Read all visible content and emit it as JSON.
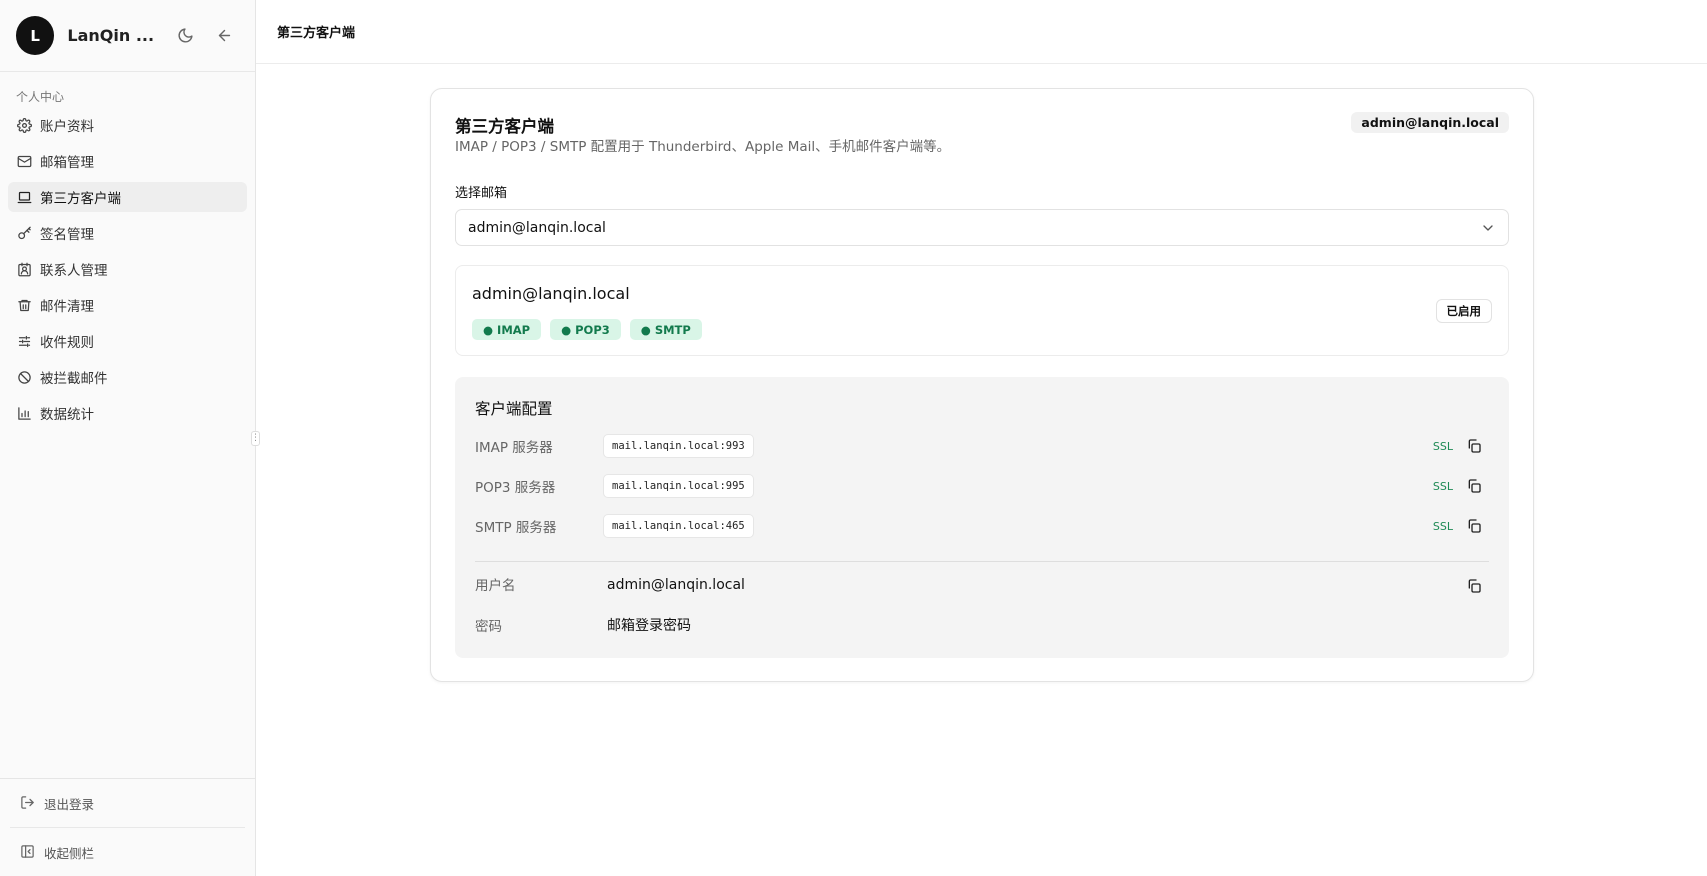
{
  "sidebar": {
    "avatar_letter": "L",
    "brand": "LanQin ...",
    "group_label": "个人中心",
    "items": [
      {
        "label": "账户资料",
        "icon": "gear-icon"
      },
      {
        "label": "邮箱管理",
        "icon": "mail-icon"
      },
      {
        "label": "第三方客户端",
        "icon": "laptop-icon",
        "active": true
      },
      {
        "label": "签名管理",
        "icon": "key-icon"
      },
      {
        "label": "联系人管理",
        "icon": "contact-icon"
      },
      {
        "label": "邮件清理",
        "icon": "trash-icon"
      },
      {
        "label": "收件规则",
        "icon": "sliders-icon"
      },
      {
        "label": "被拦截邮件",
        "icon": "ban-icon"
      },
      {
        "label": "数据统计",
        "icon": "bar-chart-icon"
      }
    ],
    "logout_label": "退出登录",
    "collapse_label": "收起侧栏"
  },
  "topbar": {
    "title": "第三方客户端"
  },
  "card": {
    "title": "第三方客户端",
    "description": "IMAP / POP3 / SMTP 配置用于 Thunderbird、Apple Mail、手机邮件客户端等。",
    "badge": "admin@lanqin.local",
    "select_label": "选择邮箱",
    "select_value": "admin@lanqin.local",
    "account": {
      "email": "admin@lanqin.local",
      "protocols": [
        "● IMAP",
        "● POP3",
        "● SMTP"
      ],
      "status": "已启用"
    },
    "config": {
      "title": "客户端配置",
      "servers": [
        {
          "label": "IMAP 服务器",
          "host": "mail.lanqin.local:993",
          "security": "SSL"
        },
        {
          "label": "POP3 服务器",
          "host": "mail.lanqin.local:995",
          "security": "SSL"
        },
        {
          "label": "SMTP 服务器",
          "host": "mail.lanqin.local:465",
          "security": "SSL"
        }
      ],
      "username_label": "用户名",
      "username": "admin@lanqin.local",
      "password_label": "密码",
      "password": "邮箱登录密码"
    }
  },
  "colors": {
    "accent_green": "#1e8a55",
    "tag_bg": "#d9f5e7",
    "sidebar_bg": "#fafafa",
    "active_item_bg": "#eeeeee"
  }
}
